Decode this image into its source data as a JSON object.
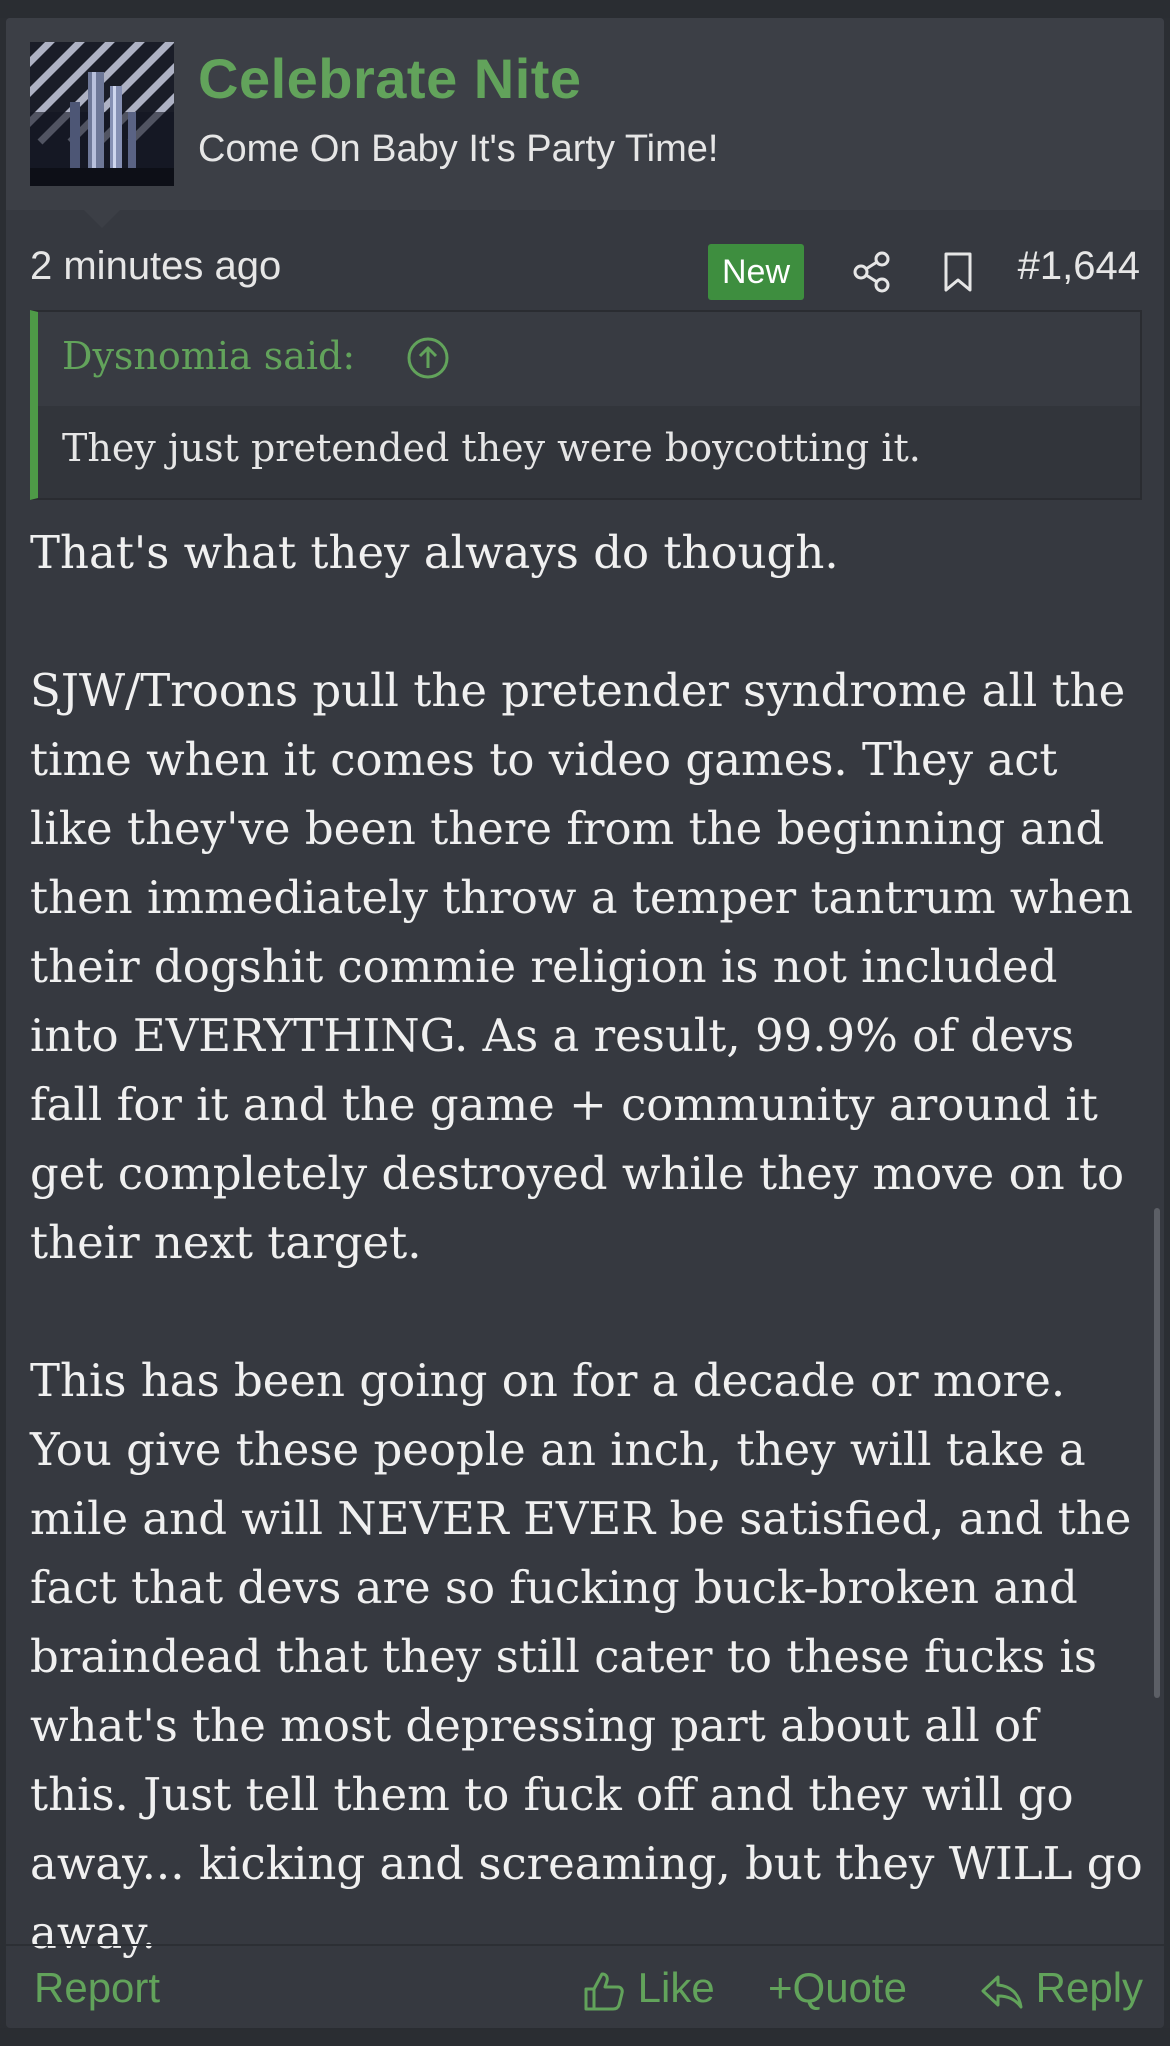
{
  "user": {
    "name": "Celebrate Nite",
    "title": "Come On Baby It's Party Time!"
  },
  "meta": {
    "timestamp": "2 minutes ago",
    "new_badge": "New",
    "post_number": "#1,644"
  },
  "quote": {
    "author": "Dysnomia said:",
    "text": "They just pretended they were boycotting it."
  },
  "message": {
    "paragraphs": [
      "That's what they always do though.",
      "SJW/Troons pull the pretender syndrome all the time when it comes to video games. They act like they've been there from the beginning and then immediately throw a temper tantrum when their dogshit commie religion is not included into EVERYTHING. As a result, 99.9% of devs fall for it and the game + community around it get completely destroyed while they move on to their next target.",
      "This has been going on for a decade or more. You give these people an inch, they will take a mile and will NEVER EVER be satisfied, and the fact that devs are so fucking buck-broken and braindead that they still cater to these fucks is what's the most depressing part about all of this. Just tell them to fuck off and they will go away... kicking and screaming, but they WILL go away."
    ]
  },
  "actions": {
    "report": "Report",
    "like": "Like",
    "quote": "Quote",
    "quote_prefix": "+",
    "reply": "Reply"
  },
  "icons": {
    "share": "share-icon",
    "bookmark": "bookmark-icon",
    "expand_quote": "arrow-up-circle-icon",
    "like": "thumbs-up-icon",
    "reply": "reply-arrow-icon"
  },
  "colors": {
    "accent_green": "#62a35b",
    "badge_green": "#3e8e3f",
    "background": "#363940",
    "header_bg": "#3c3f46",
    "text": "#f0f0f0"
  }
}
